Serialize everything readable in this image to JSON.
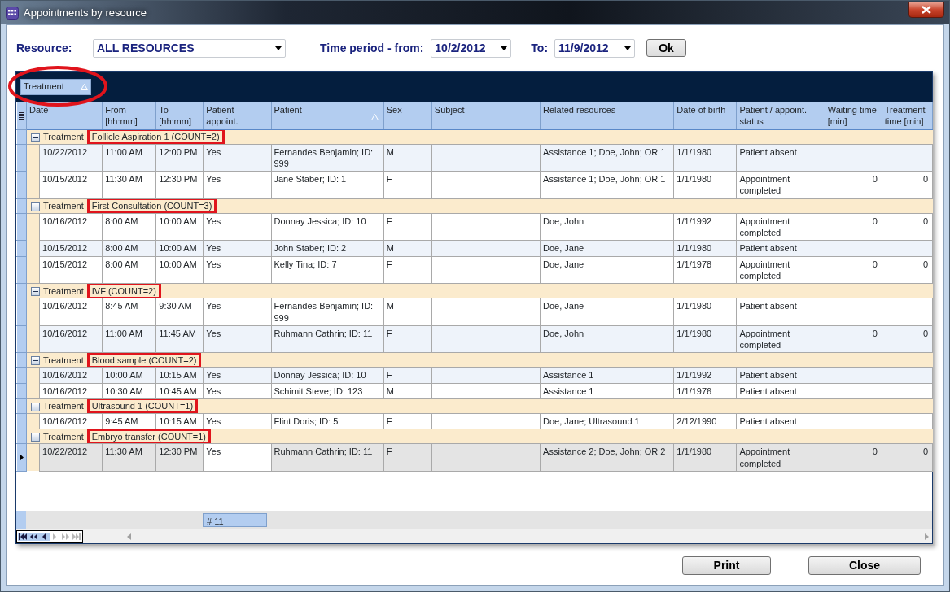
{
  "window": {
    "title": "Appointments by resource"
  },
  "filters": {
    "resource_label": "Resource:",
    "resource": "ALL RESOURCES",
    "from_label": "Time period - from:",
    "from": "10/2/2012",
    "to_label": "To:",
    "to": "11/9/2012",
    "ok": "Ok"
  },
  "group_by": {
    "label": "Treatment",
    "circled": true
  },
  "columns": [
    {
      "label": "Date",
      "kind": "text",
      "sorted": false
    },
    {
      "label": "From [hh:mm]",
      "kind": "text",
      "sorted": false
    },
    {
      "label": "To [hh:mm]",
      "kind": "text",
      "sorted": false
    },
    {
      "label": "Patient appoint.",
      "kind": "text",
      "sorted": false
    },
    {
      "label": "Patient",
      "kind": "text",
      "sorted": true
    },
    {
      "label": "Sex",
      "kind": "text",
      "sorted": false
    },
    {
      "label": "Subject",
      "kind": "text",
      "sorted": false
    },
    {
      "label": "Related resources",
      "kind": "text",
      "sorted": false
    },
    {
      "label": "Date of birth",
      "kind": "text",
      "sorted": false
    },
    {
      "label": "Patient / appoint. status",
      "kind": "text",
      "sorted": false
    },
    {
      "label": "Waiting time [min]",
      "kind": "number",
      "sorted": false
    },
    {
      "label": "Treatment time [min]",
      "kind": "number",
      "sorted": false
    }
  ],
  "groups": [
    {
      "field": "Treatment",
      "label": "Follicle Aspiration 1 (COUNT=2)",
      "highlighted": true,
      "expanded": true,
      "rows": [
        {
          "cells": [
            "10/22/2012",
            "11:00 AM",
            "12:00 PM",
            "Yes",
            "Fernandes Benjamin; ID: 999",
            "M",
            null,
            "Assistance 1; Doe, John; OR 1",
            "1/1/1980",
            "Patient absent",
            null,
            null
          ],
          "shaded": true,
          "selected": false
        },
        {
          "cells": [
            "10/15/2012",
            "11:30 AM",
            "12:30 PM",
            "Yes",
            "Jane Staber; ID: 1",
            "F",
            null,
            "Assistance 1; Doe, John; OR 1",
            "1/1/1980",
            "Appointment completed",
            "0",
            "0"
          ],
          "shaded": false,
          "selected": false
        }
      ]
    },
    {
      "field": "Treatment",
      "label": "First Consultation (COUNT=3)",
      "highlighted": true,
      "expanded": true,
      "rows": [
        {
          "cells": [
            "10/16/2012",
            "8:00 AM",
            "10:00 AM",
            "Yes",
            "Donnay Jessica; ID: 10",
            "F",
            null,
            "Doe, John",
            "1/1/1992",
            "Appointment completed",
            "0",
            "0"
          ],
          "shaded": false,
          "selected": false
        },
        {
          "cells": [
            "10/15/2012",
            "8:00 AM",
            "10:00 AM",
            "Yes",
            "John Staber; ID: 2",
            "M",
            null,
            "Doe, Jane",
            "1/1/1980",
            "Patient absent",
            null,
            null
          ],
          "shaded": true,
          "selected": false
        },
        {
          "cells": [
            "10/15/2012",
            "8:00 AM",
            "10:00 AM",
            "Yes",
            "Kelly Tina; ID: 7",
            "F",
            null,
            "Doe, Jane",
            "1/1/1978",
            "Appointment completed",
            "0",
            "0"
          ],
          "shaded": false,
          "selected": false
        }
      ]
    },
    {
      "field": "Treatment",
      "label": "IVF (COUNT=2)",
      "highlighted": true,
      "expanded": true,
      "rows": [
        {
          "cells": [
            "10/16/2012",
            "8:45 AM",
            "9:30 AM",
            "Yes",
            "Fernandes Benjamin; ID: 999",
            "M",
            null,
            "Doe, Jane",
            "1/1/1980",
            "Patient absent",
            null,
            null
          ],
          "shaded": false,
          "selected": false
        },
        {
          "cells": [
            "10/16/2012",
            "11:00 AM",
            "11:45 AM",
            "Yes",
            "Ruhmann Cathrin; ID: 11",
            "F",
            null,
            "Doe, John",
            "1/1/1980",
            "Appointment completed",
            "0",
            "0"
          ],
          "shaded": true,
          "selected": false
        }
      ]
    },
    {
      "field": "Treatment",
      "label": "Blood sample (COUNT=2)",
      "highlighted": true,
      "expanded": true,
      "rows": [
        {
          "cells": [
            "10/16/2012",
            "10:00 AM",
            "10:15 AM",
            "Yes",
            "Donnay Jessica; ID: 10",
            "F",
            null,
            "Assistance 1",
            "1/1/1992",
            "Patient absent",
            null,
            null
          ],
          "shaded": true,
          "selected": false
        },
        {
          "cells": [
            "10/16/2012",
            "10:30 AM",
            "10:45 AM",
            "Yes",
            "Schimit Steve; ID: 123",
            "M",
            null,
            "Assistance 1",
            "1/1/1976",
            "Patient absent",
            null,
            null
          ],
          "shaded": false,
          "selected": false
        }
      ]
    },
    {
      "field": "Treatment",
      "label": "Ultrasound 1 (COUNT=1)",
      "highlighted": true,
      "expanded": true,
      "rows": [
        {
          "cells": [
            "10/16/2012",
            "9:45 AM",
            "10:15 AM",
            "Yes",
            "Flint Doris; ID: 5",
            "F",
            null,
            "Doe, Jane; Ultrasound 1",
            "2/12/1990",
            "Patient absent",
            null,
            null
          ],
          "shaded": false,
          "selected": false
        }
      ]
    },
    {
      "field": "Treatment",
      "label": "Embryo transfer (COUNT=1)",
      "highlighted": true,
      "expanded": true,
      "rows": [
        {
          "cells": [
            "10/22/2012",
            "11:30 AM",
            "12:30 PM",
            "Yes",
            "Ruhmann Cathrin; ID: 11",
            "F",
            null,
            "Assistance 2; Doe, John; OR 2",
            "1/1/1980",
            "Appointment completed",
            "0",
            "0"
          ],
          "shaded": false,
          "selected": true
        }
      ]
    }
  ],
  "summary": {
    "text": "# 11"
  },
  "navigator": [
    {
      "kind": "first",
      "disabled": false
    },
    {
      "kind": "prev_page",
      "disabled": false
    },
    {
      "kind": "prev",
      "disabled": false
    },
    {
      "kind": "next",
      "disabled": true
    },
    {
      "kind": "next_page",
      "disabled": true
    },
    {
      "kind": "last",
      "disabled": true
    }
  ],
  "buttons": [
    "Print",
    "Close"
  ]
}
